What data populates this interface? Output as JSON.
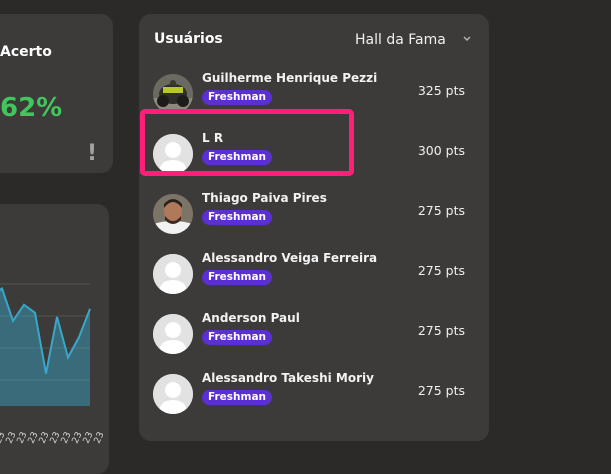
{
  "acerto": {
    "title": "Acerto",
    "value": "62%",
    "info_glyph": "!"
  },
  "chart_data": {
    "type": "area",
    "x": [
      "23",
      "23",
      "23",
      "23",
      "23",
      "23",
      "23",
      "23",
      "23",
      "23"
    ],
    "series": [
      {
        "values": [
          7.2,
          6.7,
          6.9,
          6.1,
          6.5,
          6.3,
          4.8,
          6.2,
          5.2,
          5.7,
          6.4
        ]
      }
    ],
    "color": "#38a7c9",
    "grid": true
  },
  "users": {
    "title": "Usuários",
    "filter": "Hall da Fama",
    "items": [
      {
        "name": "Guilherme Henrique Pezzi",
        "badge": "Freshman",
        "points": "325 pts",
        "avatar": "photo"
      },
      {
        "name": "L R",
        "badge": "Freshman",
        "points": "300 pts",
        "avatar": "default"
      },
      {
        "name": "Thiago Paiva Pires",
        "badge": "Freshman",
        "points": "275 pts",
        "avatar": "photo"
      },
      {
        "name": "Alessandro Veiga Ferreira",
        "badge": "Freshman",
        "points": "275 pts",
        "avatar": "default"
      },
      {
        "name": "Anderson Paul",
        "badge": "Freshman",
        "points": "275 pts",
        "avatar": "default"
      },
      {
        "name": "Alessandro Takeshi Moriy",
        "badge": "Freshman",
        "points": "275 pts",
        "avatar": "default"
      }
    ]
  },
  "colors": {
    "background": "#2b2a29",
    "card": "#3d3b39",
    "accent_green": "#41c55c",
    "badge": "#5b2fd4",
    "highlight": "#ff1e7a"
  }
}
